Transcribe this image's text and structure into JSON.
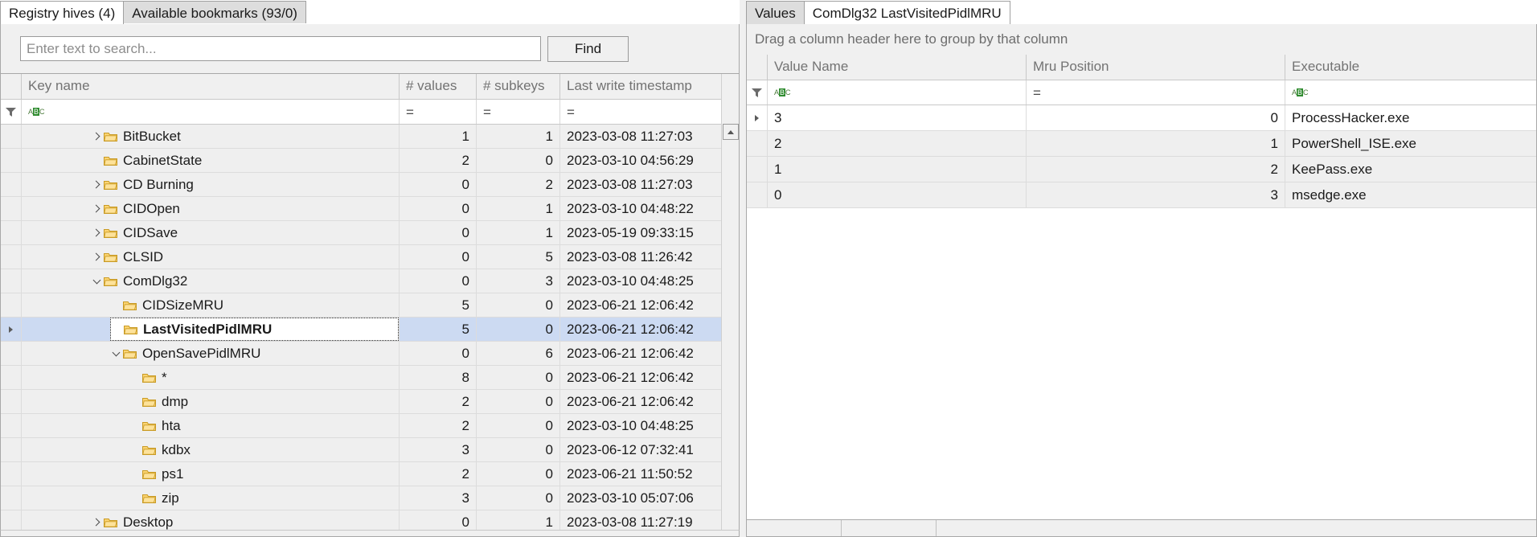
{
  "left": {
    "tabs": [
      {
        "label": "Registry hives (4)",
        "active": true
      },
      {
        "label": "Available bookmarks (93/0)",
        "active": false
      }
    ],
    "search": {
      "placeholder": "Enter text to search...",
      "value": "",
      "find_label": "Find"
    },
    "columns": [
      {
        "key": "key_name",
        "label": "Key name",
        "align": "left"
      },
      {
        "key": "num_values",
        "label": "# values",
        "align": "right"
      },
      {
        "key": "num_subkeys",
        "label": "# subkeys",
        "align": "right"
      },
      {
        "key": "last_write",
        "label": "Last write timestamp",
        "align": "left"
      }
    ],
    "filter_row": {
      "key_name": "abc-filter-icon",
      "num_values": "=",
      "num_subkeys": "=",
      "last_write": "="
    },
    "rows": [
      {
        "name": "BitBucket",
        "indent": 3,
        "expander": "right",
        "values": "1",
        "subkeys": "1",
        "timestamp": "2023-03-08 11:27:03",
        "selected": false,
        "focused": false
      },
      {
        "name": "CabinetState",
        "indent": 3,
        "expander": "none",
        "values": "2",
        "subkeys": "0",
        "timestamp": "2023-03-10 04:56:29",
        "selected": false,
        "focused": false
      },
      {
        "name": "CD Burning",
        "indent": 3,
        "expander": "right",
        "values": "0",
        "subkeys": "2",
        "timestamp": "2023-03-08 11:27:03",
        "selected": false,
        "focused": false
      },
      {
        "name": "CIDOpen",
        "indent": 3,
        "expander": "right",
        "values": "0",
        "subkeys": "1",
        "timestamp": "2023-03-10 04:48:22",
        "selected": false,
        "focused": false
      },
      {
        "name": "CIDSave",
        "indent": 3,
        "expander": "right",
        "values": "0",
        "subkeys": "1",
        "timestamp": "2023-05-19 09:33:15",
        "selected": false,
        "focused": false
      },
      {
        "name": "CLSID",
        "indent": 3,
        "expander": "right",
        "values": "0",
        "subkeys": "5",
        "timestamp": "2023-03-08 11:26:42",
        "selected": false,
        "focused": false
      },
      {
        "name": "ComDlg32",
        "indent": 3,
        "expander": "down",
        "values": "0",
        "subkeys": "3",
        "timestamp": "2023-03-10 04:48:25",
        "selected": false,
        "focused": false
      },
      {
        "name": "CIDSizeMRU",
        "indent": 4,
        "expander": "none",
        "values": "5",
        "subkeys": "0",
        "timestamp": "2023-06-21 12:06:42",
        "selected": false,
        "focused": false
      },
      {
        "name": "LastVisitedPidlMRU",
        "indent": 4,
        "expander": "none",
        "values": "5",
        "subkeys": "0",
        "timestamp": "2023-06-21 12:06:42",
        "selected": true,
        "focused": true
      },
      {
        "name": "OpenSavePidlMRU",
        "indent": 4,
        "expander": "down",
        "values": "0",
        "subkeys": "6",
        "timestamp": "2023-06-21 12:06:42",
        "selected": false,
        "focused": false
      },
      {
        "name": "*",
        "indent": 5,
        "expander": "none",
        "values": "8",
        "subkeys": "0",
        "timestamp": "2023-06-21 12:06:42",
        "selected": false,
        "focused": false
      },
      {
        "name": "dmp",
        "indent": 5,
        "expander": "none",
        "values": "2",
        "subkeys": "0",
        "timestamp": "2023-06-21 12:06:42",
        "selected": false,
        "focused": false
      },
      {
        "name": "hta",
        "indent": 5,
        "expander": "none",
        "values": "2",
        "subkeys": "0",
        "timestamp": "2023-03-10 04:48:25",
        "selected": false,
        "focused": false
      },
      {
        "name": "kdbx",
        "indent": 5,
        "expander": "none",
        "values": "3",
        "subkeys": "0",
        "timestamp": "2023-06-12 07:32:41",
        "selected": false,
        "focused": false
      },
      {
        "name": "ps1",
        "indent": 5,
        "expander": "none",
        "values": "2",
        "subkeys": "0",
        "timestamp": "2023-06-21 11:50:52",
        "selected": false,
        "focused": false
      },
      {
        "name": "zip",
        "indent": 5,
        "expander": "none",
        "values": "3",
        "subkeys": "0",
        "timestamp": "2023-03-10 05:07:06",
        "selected": false,
        "focused": false
      },
      {
        "name": "Desktop",
        "indent": 3,
        "expander": "right",
        "values": "0",
        "subkeys": "1",
        "timestamp": "2023-03-08 11:27:19",
        "selected": false,
        "focused": false
      }
    ],
    "scroll": {
      "up_icon": "arrow-up-icon"
    }
  },
  "right": {
    "tabs": [
      {
        "label": "Values",
        "active": false
      },
      {
        "label": "ComDlg32 LastVisitedPidlMRU",
        "active": true
      }
    ],
    "group_panel_text": "Drag a column header here to group by that column",
    "columns": [
      {
        "key": "value_name",
        "label": "Value Name",
        "align": "left"
      },
      {
        "key": "mru_position",
        "label": "Mru Position",
        "align": "right"
      },
      {
        "key": "executable",
        "label": "Executable",
        "align": "left"
      }
    ],
    "filter_row": {
      "value_name": "abc-filter-icon",
      "mru_position": "=",
      "executable": "abc-filter-icon"
    },
    "rows": [
      {
        "value_name": "3",
        "mru_position": "0",
        "executable": "ProcessHacker.exe",
        "current": true
      },
      {
        "value_name": "2",
        "mru_position": "1",
        "executable": "PowerShell_ISE.exe",
        "current": false
      },
      {
        "value_name": "1",
        "mru_position": "2",
        "executable": "KeePass.exe",
        "current": false
      },
      {
        "value_name": "0",
        "mru_position": "3",
        "executable": "msedge.exe",
        "current": false
      }
    ]
  },
  "colors": {
    "selection": "#ccdaf2",
    "folder": "#f7c948",
    "header_text": "#737373",
    "grid_line": "#dcdcdc",
    "chrome": "#f0f0f0"
  }
}
